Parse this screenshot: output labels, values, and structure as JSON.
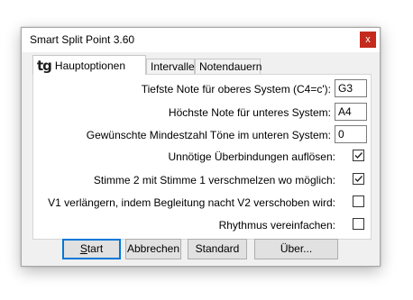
{
  "window": {
    "title": "Smart Split Point 3.60",
    "close_glyph": "x"
  },
  "tabs": [
    {
      "logo": "tg",
      "label": "Hauptoptionen",
      "active": true
    },
    {
      "label": "Intervalle",
      "active": false
    },
    {
      "label": "Notendauern",
      "active": false
    }
  ],
  "options": {
    "lowest_upper_label": "Tiefste Note für oberes System  (C4=c'):",
    "lowest_upper_value": "G3",
    "highest_lower_label": "Höchste Note für unteres System:",
    "highest_lower_value": "A4",
    "min_notes_label": "Gewünschte Mindestzahl Töne im unteren System:",
    "min_notes_value": "0",
    "resolve_ties_label": "Unnötige Überbindungen auflösen:",
    "resolve_ties_checked": true,
    "merge_voice_label": "Stimme 2 mit Stimme 1 verschmelzen wo möglich:",
    "merge_voice_checked": true,
    "extend_v1_label": "V1 verlängern, indem Begleitung nacht V2 verschoben wird:",
    "extend_v1_checked": false,
    "simplify_rhythm_label": "Rhythmus vereinfachen:",
    "simplify_rhythm_checked": false
  },
  "buttons": {
    "start_mnemonic": "S",
    "start_rest": "tart",
    "cancel": "Abbrechen",
    "default": "Standard",
    "about": "Über..."
  },
  "colors": {
    "close_button": "#c42b1c",
    "default_button_border": "#0078d7"
  }
}
